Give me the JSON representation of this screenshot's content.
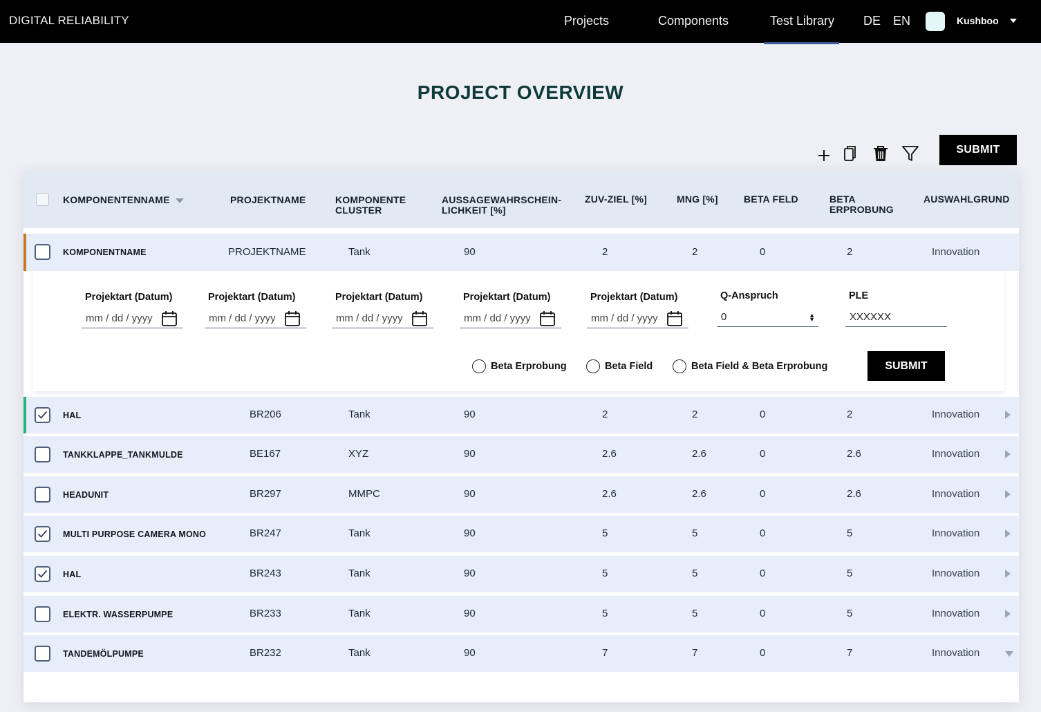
{
  "nav": {
    "brand": "DIGITAL RELIABILITY",
    "links": [
      {
        "label": "Projects"
      },
      {
        "label": "Components"
      },
      {
        "label": "Test Library"
      }
    ],
    "active": "Test Library",
    "languages": [
      "DE",
      "EN"
    ],
    "user": "Kushboo"
  },
  "page": {
    "title": "PROJECT OVERVIEW"
  },
  "toolbar": {
    "icons": [
      "plus-icon",
      "copy-icon",
      "trash-icon",
      "filter-icon"
    ],
    "submit_label": "SUBMIT"
  },
  "table": {
    "headers": {
      "name": "KOMPONENTENNAME",
      "project": "PROJEKTNAME",
      "cluster_1": "KOMPONENTE",
      "cluster_2": "CLUSTER",
      "probability_1": "AUSSAGEWAHRSCHEIN-",
      "probability_2": "LICHKEIT [%]",
      "zuv": "ZUV-ZIEL [%]",
      "mng": "MNG [%]",
      "beta_field": "BETA FELD",
      "beta_trial_1": "BETA",
      "beta_trial_2": "ERPROBUNG",
      "reason": "AUSWAHLGRUND"
    },
    "expanded_row": {
      "name": "KOMPONENTNAME",
      "project": "PROJEKTNAME",
      "cluster": "Tank",
      "probability": "90",
      "zuv": "2",
      "mng": "2",
      "beta_field": "0",
      "beta_trial": "2",
      "reason": "Innovation",
      "accent": "#c9782b"
    },
    "form": {
      "date_label": "Projektart (Datum)",
      "date_placeholder": "mm / dd / yyyy",
      "q_label": "Q-Anspruch",
      "q_value": "0",
      "ple_label": "PLE",
      "ple_value": "XXXXXX",
      "radios": [
        "Beta Erprobung",
        "Beta Field",
        "Beta Field & Beta Erprobung"
      ],
      "submit_label": "SUBMIT"
    },
    "rows": [
      {
        "name": "HAL",
        "project": "BR206",
        "cluster": "Tank",
        "probability": "90",
        "zuv": "2",
        "mng": "2",
        "beta_field": "0",
        "beta_trial": "2",
        "reason": "Innovation",
        "checked": true,
        "accent": "#25b47e"
      },
      {
        "name": "TANKKLAPPE_TANKMULDE",
        "project": "BE167",
        "cluster": "XYZ",
        "probability": "90",
        "zuv": "2.6",
        "mng": "2.6",
        "beta_field": "0",
        "beta_trial": "2.6",
        "reason": "Innovation",
        "checked": false
      },
      {
        "name": "HEADUNIT",
        "project": "BR297",
        "cluster": "MMPC",
        "probability": "90",
        "zuv": "2.6",
        "mng": "2.6",
        "beta_field": "0",
        "beta_trial": "2.6",
        "reason": "Innovation",
        "checked": false
      },
      {
        "name": "MULTI PURPOSE CAMERA MONO",
        "project": "BR247",
        "cluster": "Tank",
        "probability": "90",
        "zuv": "5",
        "mng": "5",
        "beta_field": "0",
        "beta_trial": "5",
        "reason": "Innovation",
        "checked": true
      },
      {
        "name": "HAL",
        "project": "BR243",
        "cluster": "Tank",
        "probability": "90",
        "zuv": "5",
        "mng": "5",
        "beta_field": "0",
        "beta_trial": "5",
        "reason": "Innovation",
        "checked": true
      },
      {
        "name": "ELEKTR. WASSERPUMPE",
        "project": "BR233",
        "cluster": "Tank",
        "probability": "90",
        "zuv": "5",
        "mng": "5",
        "beta_field": "0",
        "beta_trial": "5",
        "reason": "Innovation",
        "checked": false
      },
      {
        "name": "TANDEMÖLPUMPE",
        "project": "BR232",
        "cluster": "Tank",
        "probability": "90",
        "zuv": "7",
        "mng": "7",
        "beta_field": "0",
        "beta_trial": "7",
        "reason": "Innovation",
        "checked": false
      }
    ]
  }
}
